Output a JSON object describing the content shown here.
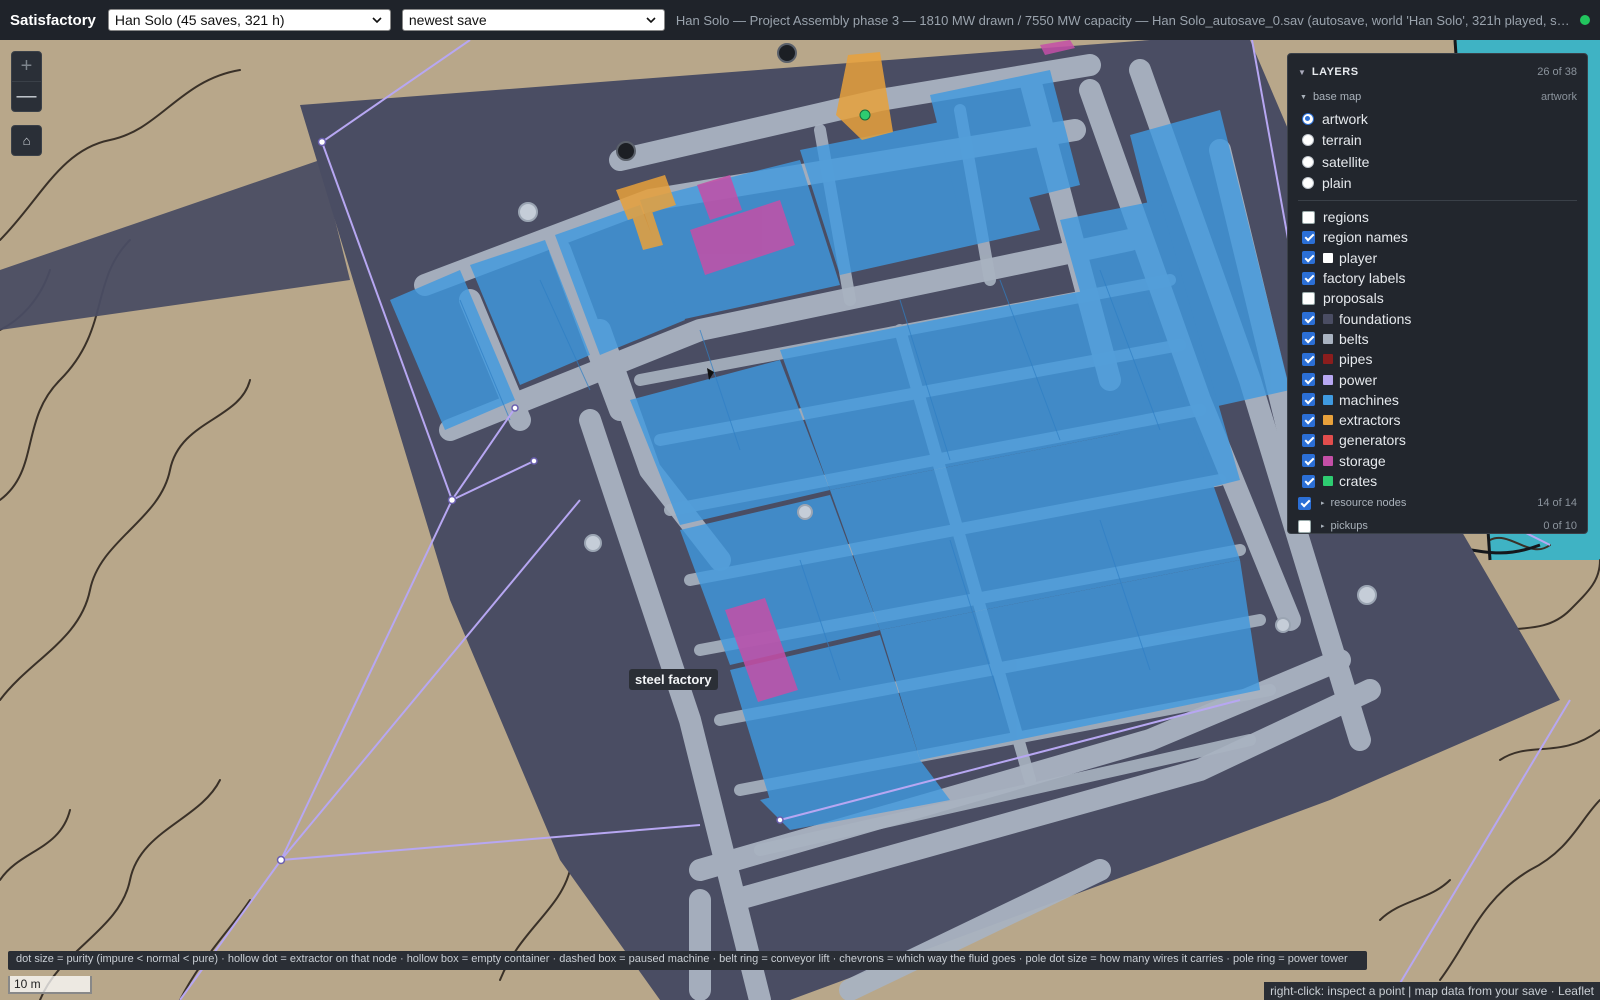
{
  "app": {
    "title": "Satisfactory"
  },
  "topbar": {
    "save_select": "Han Solo (45 saves, 321 h)",
    "version_select": "newest save",
    "status": "Han Solo — Project Assembly phase 3 — 1810 MW drawn / 7550 MW capacity — Han Solo_autosave_0.sav (autosave, world 'Han Solo', 321h played, saveV..."
  },
  "zoom": {
    "in_label": "+",
    "out_label": "—",
    "home_label": "⌂"
  },
  "layers": {
    "title": "LAYERS",
    "count": "26 of 38",
    "base_map": {
      "label": "base map",
      "current": "artwork",
      "options": [
        {
          "label": "artwork",
          "selected": true
        },
        {
          "label": "terrain",
          "selected": false
        },
        {
          "label": "satellite",
          "selected": false
        },
        {
          "label": "plain",
          "selected": false
        }
      ]
    },
    "items": [
      {
        "label": "regions",
        "checked": false,
        "color": ""
      },
      {
        "label": "region names",
        "checked": true,
        "color": ""
      },
      {
        "label": "player",
        "checked": true,
        "color": "#ffffff"
      },
      {
        "label": "factory labels",
        "checked": true,
        "color": ""
      },
      {
        "label": "proposals",
        "checked": false,
        "color": ""
      },
      {
        "label": "foundations",
        "checked": true,
        "color": "#4a4d63"
      },
      {
        "label": "belts",
        "checked": true,
        "color": "#a9b3c1"
      },
      {
        "label": "pipes",
        "checked": true,
        "color": "#8b1d1d"
      },
      {
        "label": "power",
        "checked": true,
        "color": "#b7a7f2"
      },
      {
        "label": "machines",
        "checked": true,
        "color": "#3f9ae0"
      },
      {
        "label": "extractors",
        "checked": true,
        "color": "#e8a13b"
      },
      {
        "label": "generators",
        "checked": true,
        "color": "#e14d4d"
      },
      {
        "label": "storage",
        "checked": true,
        "color": "#c44fa7"
      },
      {
        "label": "crates",
        "checked": true,
        "color": "#2ecc71"
      }
    ],
    "groups": [
      {
        "label": "resource nodes",
        "checked": true,
        "count": "14 of 14"
      },
      {
        "label": "pickups",
        "checked": false,
        "count": "0 of 10"
      }
    ]
  },
  "map": {
    "factory_label": "steel factory"
  },
  "legend": "dot size = purity (impure < normal < pure) · hollow dot = extractor on that node · hollow box = empty container · dashed box = paused machine · belt ring = conveyor lift · chevrons = which way the fluid goes · pole dot size = how many wires it carries · pole ring = power tower",
  "scale": "10 m",
  "attribution": "right-click: inspect a point | map data from your save · Leaflet",
  "colors": {
    "foundation": "#4a4d63",
    "belt": "#a9b3c1",
    "machine": "#3f9ae0",
    "storage": "#c44fa7",
    "extractor": "#e8a13b",
    "power": "#b7a7f2",
    "ground": "#b8a78a",
    "water": "#3fb3c4"
  }
}
